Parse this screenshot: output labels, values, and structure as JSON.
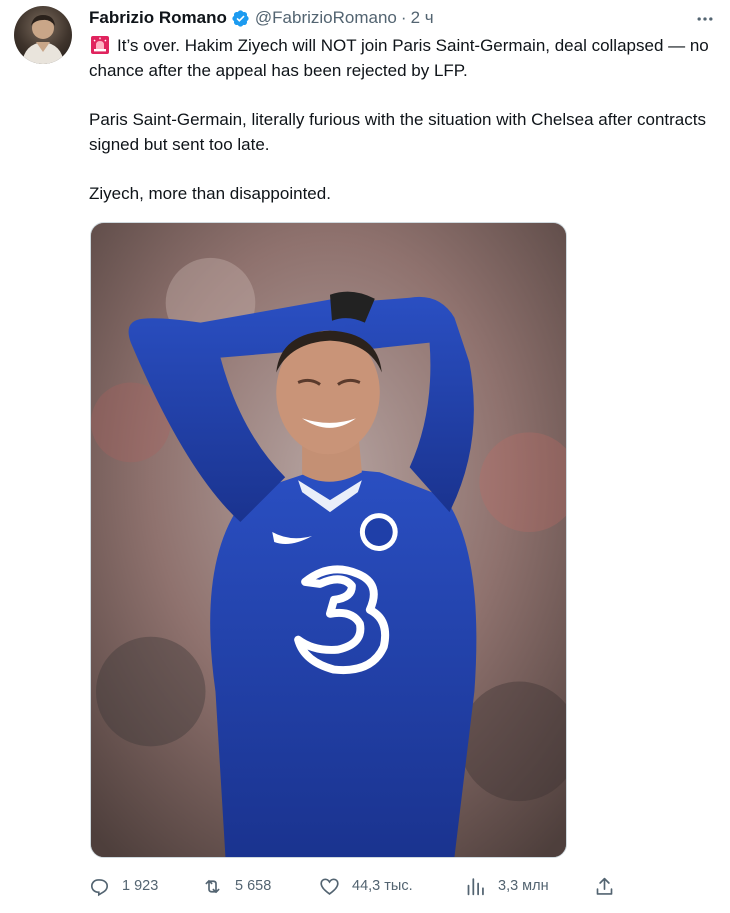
{
  "author": {
    "display_name": "Fabrizio Romano",
    "handle": "@FabrizioRomano",
    "separator": "·",
    "timestamp": "2 ч",
    "verified": true,
    "badge_color": "#1d9bf0"
  },
  "tweet": {
    "lead_icon": "rotating-light-emoji",
    "paragraphs": [
      "It’s over. Hakim Ziyech will NOT join Paris Saint-Germain, deal collapsed — no chance after the appeal has been rejected by LFP.",
      "Paris Saint-Germain, literally furious with the situation with Chelsea after contracts signed but sent too late.",
      "Ziyech, more than disappointed."
    ]
  },
  "media": {
    "kind": "photo",
    "subject": "footballer-in-blue-kit-hands-on-head"
  },
  "actions": {
    "reply_count": "1 923",
    "retweet_count": "5 658",
    "like_count": "44,3 тыс.",
    "view_count": "3,3 млн"
  },
  "colors": {
    "text_primary": "#0f1419",
    "text_secondary": "#536471",
    "brand_blue": "#1d9bf0",
    "kit_blue": "#1f3fa8"
  }
}
